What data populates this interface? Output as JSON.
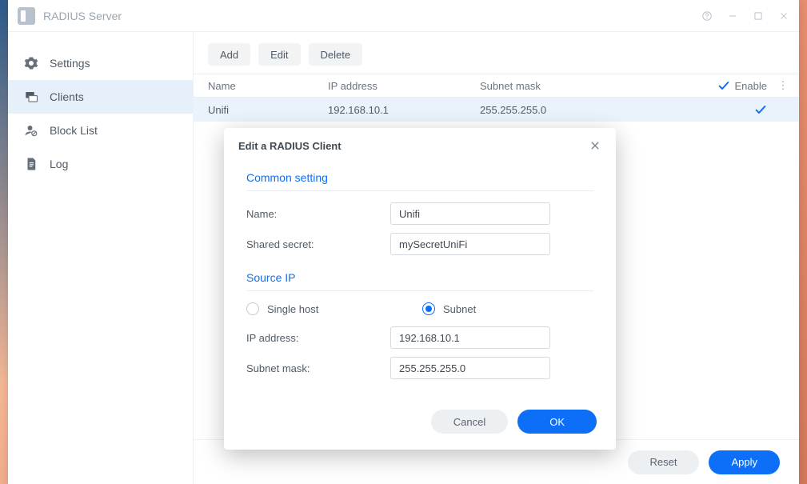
{
  "window": {
    "title": "RADIUS Server"
  },
  "sidebar": {
    "items": [
      {
        "id": "settings",
        "label": "Settings"
      },
      {
        "id": "clients",
        "label": "Clients"
      },
      {
        "id": "blocklist",
        "label": "Block List"
      },
      {
        "id": "log",
        "label": "Log"
      }
    ],
    "active": "clients"
  },
  "toolbar": {
    "add_label": "Add",
    "edit_label": "Edit",
    "delete_label": "Delete"
  },
  "table": {
    "headers": {
      "name": "Name",
      "ip": "IP address",
      "subnet": "Subnet mask",
      "enable": "Enable"
    },
    "rows": [
      {
        "name": "Unifi",
        "ip": "192.168.10.1",
        "subnet": "255.255.255.0",
        "enabled": true
      }
    ]
  },
  "footer": {
    "reset_label": "Reset",
    "apply_label": "Apply"
  },
  "modal": {
    "title": "Edit a RADIUS Client",
    "section_common": "Common setting",
    "name_label": "Name:",
    "name_value": "Unifi",
    "secret_label": "Shared secret:",
    "secret_value": "mySecretUniFi",
    "section_source": "Source IP",
    "radio_single": "Single host",
    "radio_subnet": "Subnet",
    "radio_selected": "subnet",
    "ip_label": "IP address:",
    "ip_value": "192.168.10.1",
    "mask_label": "Subnet mask:",
    "mask_value": "255.255.255.0",
    "cancel_label": "Cancel",
    "ok_label": "OK"
  }
}
